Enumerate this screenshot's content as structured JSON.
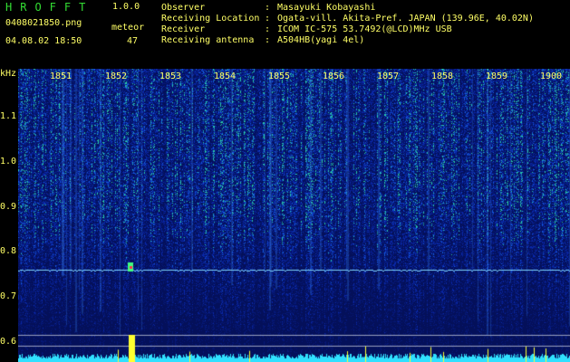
{
  "header": {
    "logo": "HROFFT",
    "version": "1.0.0",
    "file_name": "0408021850.png",
    "date_time": "04.08.02 18:50",
    "meteor_label": "meteor",
    "meteor_count": "47"
  },
  "info": [
    {
      "key": "Observer",
      "sep": ":",
      "value": "Masayuki Kobayashi"
    },
    {
      "key": "Receiving Location",
      "sep": ":",
      "value": "Ogata-vill. Akita-Pref. JAPAN (139.96E, 40.02N)"
    },
    {
      "key": "Receiver",
      "sep": ":",
      "value": "ICOM IC-575 53.7492(@LCD)MHz USB"
    },
    {
      "key": "Receiving antenna",
      "sep": ":",
      "value": "A504HB(yagi 4el)"
    }
  ],
  "axis": {
    "y_unit": "kHz",
    "y_ticks": [
      "1.1",
      "1.0",
      "0.9",
      "0.8",
      "0.7",
      "0.6"
    ],
    "x_ticks": [
      "1851",
      "1852",
      "1853",
      "1854",
      "1855",
      "1856",
      "1857",
      "1858",
      "1859",
      "1900"
    ]
  },
  "colors": {
    "background": "#04105a",
    "text": "#ffff66",
    "logo": "#33dd33"
  }
}
